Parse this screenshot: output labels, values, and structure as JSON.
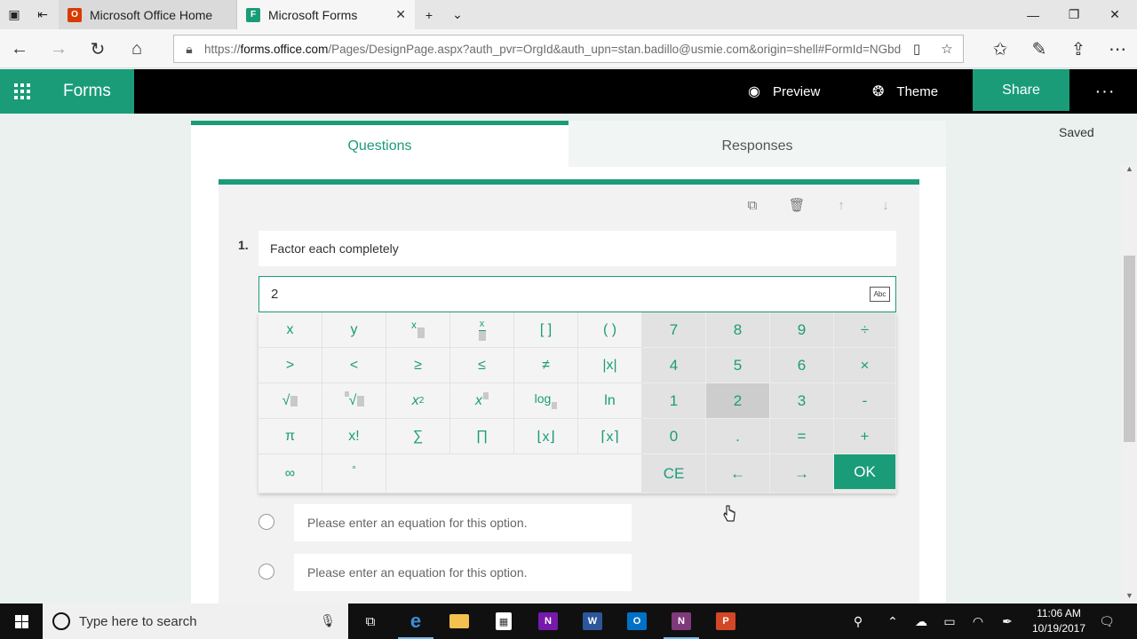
{
  "browser": {
    "tabs": [
      {
        "title": "Microsoft Office Home",
        "icon": "office-icon",
        "color": "#d83b01"
      },
      {
        "title": "Microsoft Forms",
        "icon": "forms-icon",
        "color": "#1a9c78"
      }
    ],
    "url_prefix": "https://",
    "url_host": "forms.office.com",
    "url_path": "/Pages/DesignPage.aspx?auth_pvr=OrgId&auth_upn=stan.badillo@usmie.com&origin=shell#FormId=NGbdODE"
  },
  "app": {
    "name": "Forms",
    "brand_color": "#1a9c78",
    "preview_label": "Preview",
    "theme_label": "Theme",
    "share_label": "Share",
    "more_label": "···",
    "status": "Saved"
  },
  "form_tabs": {
    "questions": "Questions",
    "responses": "Responses"
  },
  "question": {
    "number": "1.",
    "title": "Factor each completely",
    "equation_value": "2",
    "abc_label": "Abc"
  },
  "keypad": {
    "keys": [
      [
        "x",
        "y",
        "",
        "",
        "[ ]",
        "( )",
        "7",
        "8",
        "9",
        "÷"
      ],
      [
        ">",
        "<",
        "≥",
        "≤",
        "≠",
        "|x|",
        "4",
        "5",
        "6",
        "×"
      ],
      [
        "√",
        "√",
        "x2",
        "x",
        "log",
        "ln",
        "1",
        "2",
        "3",
        "-"
      ],
      [
        "π",
        "x!",
        "∑",
        "∏",
        "⌊x⌋",
        "⌈x⌉",
        "0",
        ".",
        "=",
        "+"
      ],
      [
        "∞",
        "°",
        "",
        "",
        "",
        "",
        "CE",
        "←",
        "→",
        "OK"
      ]
    ]
  },
  "options": [
    {
      "placeholder": "Please enter an equation for this option."
    },
    {
      "placeholder": "Please enter an equation for this option."
    }
  ],
  "taskbar": {
    "search_placeholder": "Type here to search",
    "time": "11:06 AM",
    "date": "10/19/2017"
  }
}
